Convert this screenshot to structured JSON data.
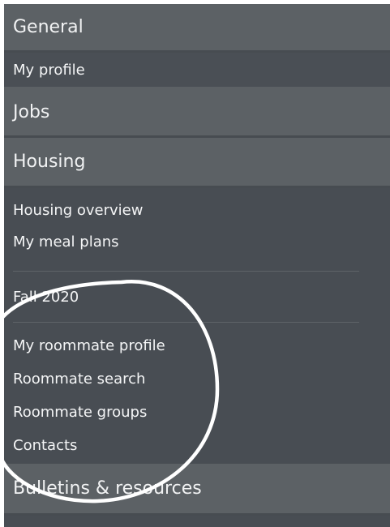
{
  "sections": {
    "general": {
      "header": "General",
      "items": [
        "My profile"
      ]
    },
    "jobs": {
      "header": "Jobs"
    },
    "housing": {
      "header": "Housing",
      "items_top": [
        "Housing overview",
        "My meal plans"
      ],
      "term": "Fall 2020",
      "items_roommate": [
        "My roommate profile",
        "Roommate search",
        "Roommate groups",
        "Contacts"
      ]
    },
    "bulletins": {
      "header": "Bulletins & resources"
    }
  },
  "colors": {
    "panel_bg": "#484d53",
    "header_bg": "#5c6165",
    "text": "#f4f5f6",
    "annotation": "#ffffff"
  },
  "annotation": {
    "shape": "hand-drawn circle around roommate items"
  }
}
